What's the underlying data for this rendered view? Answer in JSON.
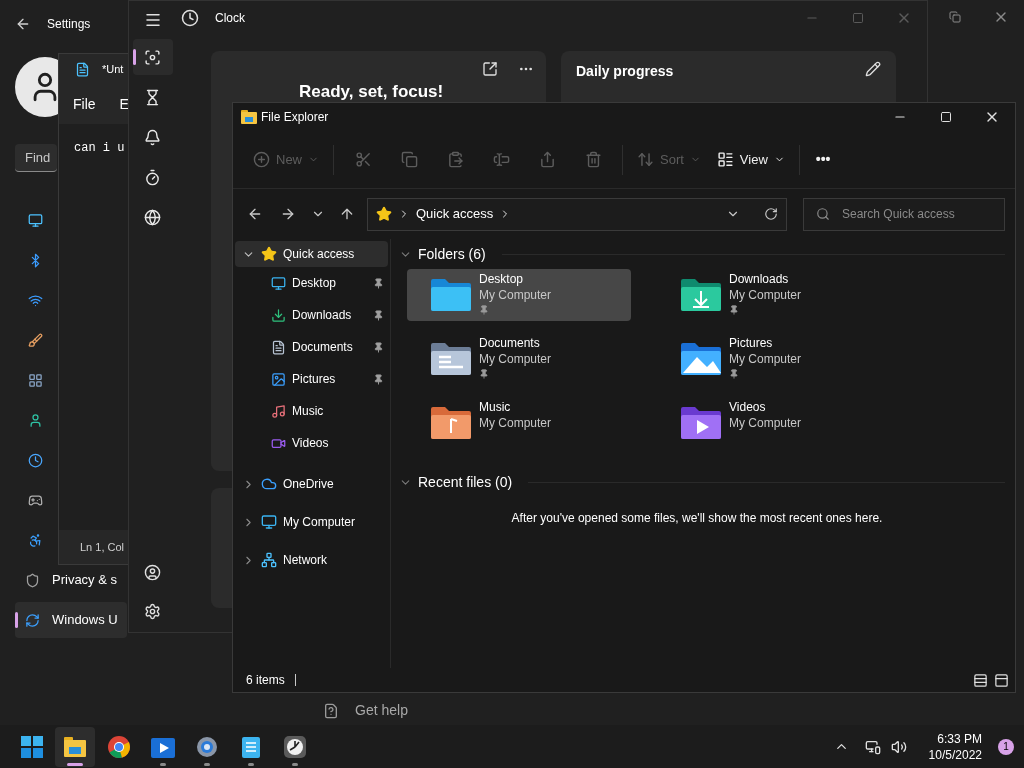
{
  "settings": {
    "title": "Settings",
    "search_placeholder": "Find",
    "nav_items": [
      {
        "label": "Privacy & s",
        "selected": false
      },
      {
        "label": "Windows U",
        "selected": true
      }
    ],
    "get_help": "Get help"
  },
  "notepad": {
    "title": "*Unt",
    "menu": [
      "File",
      "E"
    ],
    "text": "can i u",
    "status": "Ln 1, Col"
  },
  "clock": {
    "title": "Clock",
    "nav_items": [
      {
        "selected": true
      },
      {
        "selected": false
      },
      {
        "selected": false
      },
      {
        "selected": false
      },
      {
        "selected": false
      }
    ],
    "focus_title": "Ready, set, focus!",
    "progress_title": "Daily progress"
  },
  "explorer": {
    "title": "File Explorer",
    "toolbar": [
      {
        "kind": "menu",
        "label": "New",
        "disabled": true
      },
      {
        "kind": "icon",
        "disabled": true
      },
      {
        "kind": "icon",
        "disabled": true
      },
      {
        "kind": "icon",
        "disabled": true
      },
      {
        "kind": "icon",
        "disabled": true
      },
      {
        "kind": "icon",
        "disabled": true
      },
      {
        "kind": "icon",
        "disabled": true
      },
      {
        "kind": "menu",
        "label": "Sort",
        "disabled": true
      },
      {
        "kind": "menu",
        "label": "View",
        "disabled": false
      },
      {
        "kind": "more",
        "label": "•••",
        "disabled": false
      }
    ],
    "address": "Quick access",
    "search_placeholder": "Search Quick access",
    "tree": [
      {
        "label": "Quick access",
        "expanded": true,
        "selected": true,
        "children": [
          {
            "label": "Desktop",
            "pinned": true
          },
          {
            "label": "Downloads",
            "pinned": true
          },
          {
            "label": "Documents",
            "pinned": true
          },
          {
            "label": "Pictures",
            "pinned": true
          },
          {
            "label": "Music",
            "pinned": false
          },
          {
            "label": "Videos",
            "pinned": false
          }
        ]
      },
      {
        "label": "OneDrive",
        "expanded": false,
        "selected": false
      },
      {
        "label": "My Computer",
        "expanded": false,
        "selected": false
      },
      {
        "label": "Network",
        "expanded": false,
        "selected": false
      }
    ],
    "folders_heading": "Folders (6)",
    "folders": [
      {
        "name": "Desktop",
        "location": "My Computer",
        "pinned": true,
        "selected": true
      },
      {
        "name": "Downloads",
        "location": "My Computer",
        "pinned": true,
        "selected": false
      },
      {
        "name": "Documents",
        "location": "My Computer",
        "pinned": true,
        "selected": false
      },
      {
        "name": "Pictures",
        "location": "My Computer",
        "pinned": true,
        "selected": false
      },
      {
        "name": "Music",
        "location": "My Computer",
        "pinned": false,
        "selected": false
      },
      {
        "name": "Videos",
        "location": "My Computer",
        "pinned": false,
        "selected": false
      }
    ],
    "recent_heading": "Recent files (0)",
    "recent_empty": "After you've opened some files, we'll show the most recent ones here.",
    "status": "6 items"
  },
  "taskbar": {
    "apps": [
      {
        "active": true,
        "running": true
      },
      {
        "active": false,
        "running": false
      },
      {
        "active": false,
        "running": true
      },
      {
        "active": false,
        "running": true
      },
      {
        "active": false,
        "running": true
      },
      {
        "active": false,
        "running": true
      }
    ],
    "time": "6:33 PM",
    "date": "10/5/2022",
    "notifications": "1"
  }
}
